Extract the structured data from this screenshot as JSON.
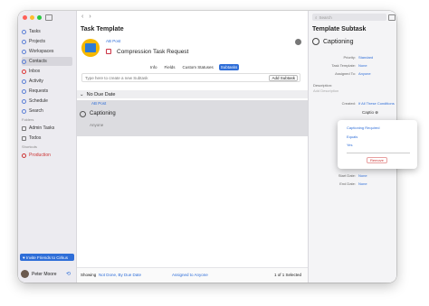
{
  "sidebar": {
    "items": [
      {
        "label": "Tasks"
      },
      {
        "label": "Projects"
      },
      {
        "label": "Workspaces"
      },
      {
        "label": "Contacts"
      },
      {
        "label": "Inbox"
      },
      {
        "label": "Activity"
      },
      {
        "label": "Requests"
      },
      {
        "label": "Schedule"
      },
      {
        "label": "Search"
      }
    ],
    "folders_label": "Folders",
    "folders": [
      {
        "label": "Admin Tasks"
      },
      {
        "label": "Todos"
      }
    ],
    "shortcuts_label": "Shortcuts",
    "shortcuts": [
      {
        "label": "Production"
      }
    ],
    "invite_label": "Invite Friends to Cirkus",
    "user_name": "Peter Moore"
  },
  "main": {
    "title": "Task Template",
    "company": "AB Post",
    "task_name": "Compression Task Request",
    "tabs": [
      {
        "label": "Info",
        "active": false
      },
      {
        "label": "Fields",
        "active": false
      },
      {
        "label": "Custom Statuses",
        "active": false
      },
      {
        "label": "Subtasks",
        "active": true
      }
    ],
    "new_subtask_placeholder": "Type here to create a new Subtask",
    "add_subtask_label": "Add Subtask",
    "group_label": "No Due Date",
    "row": {
      "company": "AB Post",
      "title": "Captioning",
      "assignee": "Anyone"
    },
    "bottom": {
      "showing_label": "Showing",
      "filter": "Not Done, By Due Date",
      "assigned": "Assigned to Anyone",
      "count": "1 of 1 Selected"
    }
  },
  "detail": {
    "search_placeholder": "Search",
    "title": "Template Subtask",
    "name": "Captioning",
    "fields": [
      {
        "label": "Priority:",
        "value": "Standard"
      },
      {
        "label": "Task Template:",
        "value": "None"
      },
      {
        "label": "Assigned To:",
        "value": "Anyone"
      }
    ],
    "description_label": "Description:",
    "description_placeholder": "Add Description",
    "created_label": "Created:",
    "conditions_value": "If All These Conditions",
    "chip_label": "Captio",
    "start_date_label": "Start Date:",
    "start_date_value": "None",
    "end_date_label": "End Date:",
    "end_date_value": "None"
  },
  "popup": {
    "line1": "Captioning Required",
    "line2": "Equals",
    "line3": "Yes",
    "remove_label": "Remove"
  },
  "colors": {
    "accent": "#2f6ed8",
    "logo_bg": "#f5b800",
    "close": "#ff5f57",
    "minimize": "#febc2e",
    "maximize": "#28c840"
  }
}
